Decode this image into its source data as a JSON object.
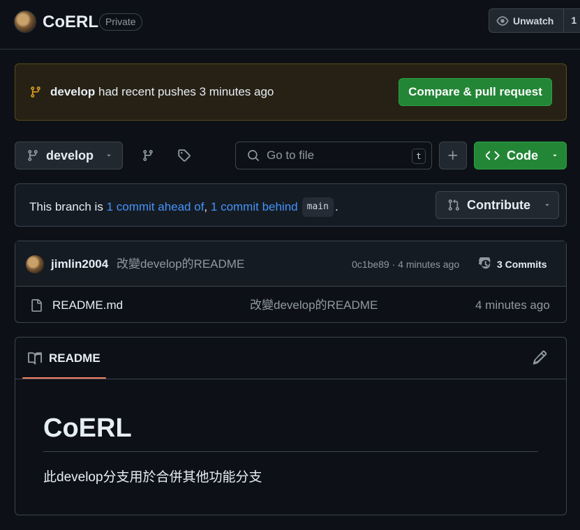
{
  "header": {
    "repo_name": "CoERL",
    "visibility_badge": "Private",
    "unwatch_label": "Unwatch",
    "watch_count": "1"
  },
  "push_banner": {
    "branch": "develop",
    "message": "had recent pushes 3 minutes ago",
    "compare_button": "Compare & pull request"
  },
  "toolbar": {
    "branch_label": "develop",
    "search_placeholder": "Go to file",
    "search_shortcut": "t",
    "code_label": "Code"
  },
  "branch_status": {
    "prefix": "This branch is",
    "ahead_link": "1 commit ahead of",
    "separator": ",",
    "behind_link": "1 commit behind",
    "base_branch": "main",
    "suffix": ".",
    "contribute_label": "Contribute"
  },
  "latest_commit": {
    "author": "jimlin2004",
    "message": "改變develop的README",
    "meta": "0c1be89 · 4 minutes ago",
    "commits_label": "3 Commits"
  },
  "files": [
    {
      "name": "README.md",
      "message": "改變develop的README",
      "time": "4 minutes ago"
    }
  ],
  "readme": {
    "tab_label": "README",
    "title": "CoERL",
    "body": "此develop分支用於合併其他功能分支"
  },
  "colors": {
    "background": "#0d1117",
    "primary_button": "#238636",
    "link": "#4493f8",
    "banner": "#272115",
    "tab_underline": "#f78166"
  }
}
